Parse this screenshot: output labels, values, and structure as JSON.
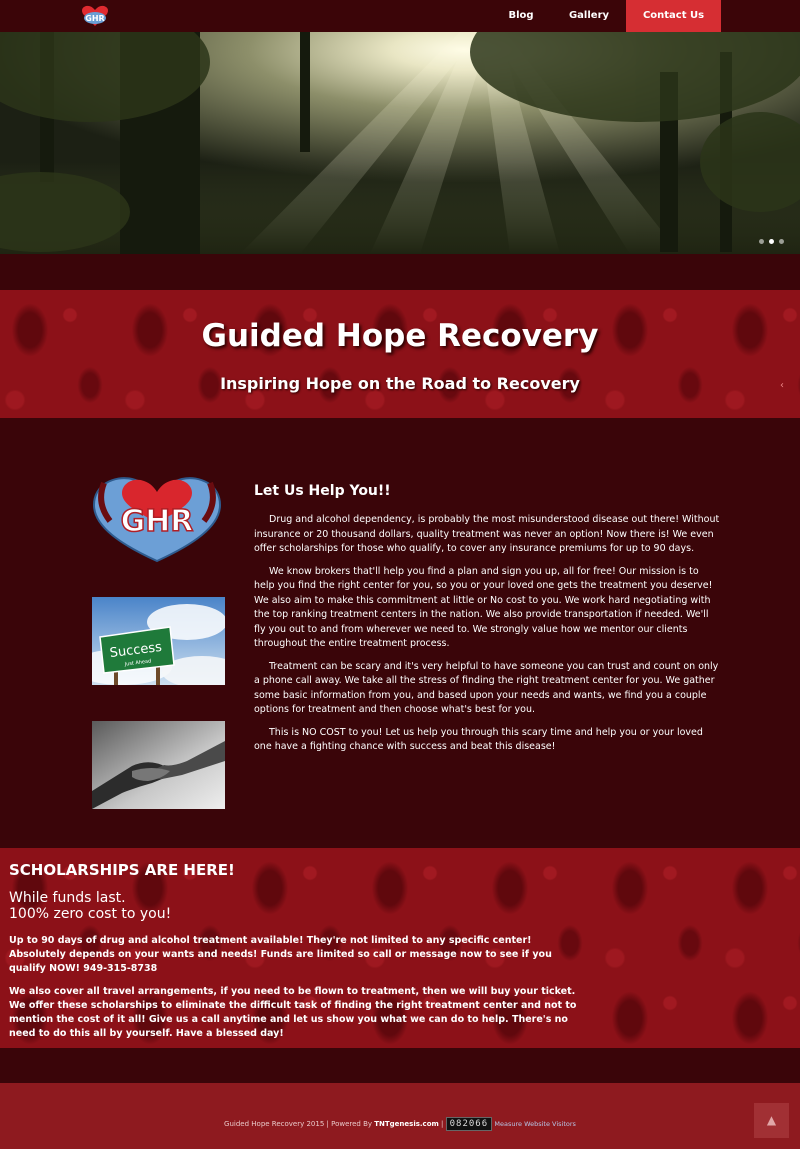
{
  "nav": {
    "blog": "Blog",
    "gallery": "Gallery",
    "contact": "Contact Us"
  },
  "hero": {
    "slides_total": 3,
    "slide_active": 2
  },
  "band1": {
    "title": "Guided Hope Recovery",
    "subtitle": "Inspiring Hope on the Road to Recovery"
  },
  "content": {
    "heading": "Let Us Help You!!",
    "paragraphs": [
      "Drug and alcohol dependency, is probably the most misunderstood disease out there! Without insurance or 20 thousand dollars, quality treatment was never an option! Now there is! We even offer scholarships for those who qualify, to cover any insurance premiums for up to 90 days.",
      "We know brokers that'll help you find a plan and sign you up, all for free! Our mission is to help you find the right center for you, so you or your loved one gets the treatment you deserve! We also aim to make this commitment at little or No cost to you. We work hard negotiating with the top ranking treatment centers in the nation. We also provide transportation if needed. We'll fly you out to and from wherever we need to. We strongly value how we mentor our clients throughout the entire treatment process.",
      "Treatment can be scary and it's very helpful to have someone you can trust and count on only a phone call away. We take all the stress of finding the right treatment center for you. We gather some basic information from you, and based upon your needs and wants, we find you a couple options for treatment and then choose what's best for you.",
      "This is NO COST to you! Let us help you through this scary time and help you or your loved one have a fighting chance with success and beat this disease!"
    ],
    "logo_text": "GHR",
    "success_sign": "Success",
    "success_sign_small": "Just Ahead"
  },
  "scholarship": {
    "title": "SCHOLARSHIPS ARE HERE!",
    "sub1": "While funds last.",
    "sub2": "100% zero cost to you!",
    "p1": "Up to 90 days of drug and alcohol treatment available! They're not limited to any specific center! Absolutely depends on your wants and needs! Funds are limited so call or message now to see if you qualify NOW!  949-315-8738",
    "p2": "We also cover all travel arrangements, if you need to be flown to treatment, then we will buy your ticket. We offer these scholarships to eliminate the difficult task of finding the right treatment center and not to mention the cost of it all! Give us a call anytime and let us show you what we can do to help. There's no need to do this all by yourself. Have a blessed day!"
  },
  "footer": {
    "copyright": "Guided Hope Recovery 2015 | Powered By ",
    "powered": "TNTgenesis.com",
    "sep": " | ",
    "counter": "082066",
    "measure": "Measure Website Visitors",
    "to_top": "▲"
  },
  "colors": {
    "nav_bg": "#3b0508",
    "contact_bg": "#d62e33",
    "page_bg": "#3a0509",
    "damask_red": "#8c1118",
    "footer_bg": "#8e1a1f"
  }
}
